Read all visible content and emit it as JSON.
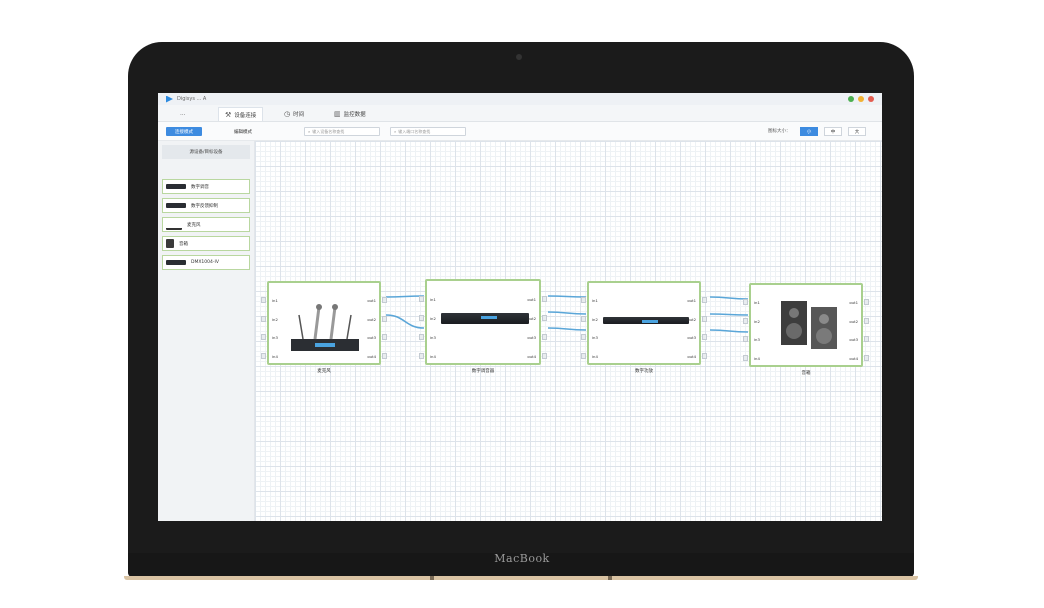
{
  "device_brand": "MacBook",
  "window": {
    "title": "Digisys ... A",
    "controls": [
      "#4caf50",
      "#f2b233",
      "#e45d50"
    ]
  },
  "tabs": [
    {
      "label": "…",
      "icon": "",
      "active": false
    },
    {
      "label": "设备连接",
      "icon": "wrench-icon",
      "active": true
    },
    {
      "label": "时间",
      "icon": "clock-icon",
      "active": false
    },
    {
      "label": "监控数据",
      "icon": "chart-icon",
      "active": false
    }
  ],
  "toolbar": {
    "primary_button": "连接模式",
    "secondary_button": "编辑模式",
    "search1_placeholder": "输入设备名称查找",
    "search2_placeholder": "输入端口名称查找",
    "size_label": "图标大小：",
    "sizes": [
      "小",
      "中",
      "大"
    ],
    "size_selected": 0
  },
  "sidebar": {
    "header": "源设备/目标设备",
    "items": [
      {
        "label": "数字调音",
        "thumb": "rack"
      },
      {
        "label": "数字反馈抑制",
        "thumb": "rack"
      },
      {
        "label": "麦克风",
        "thumb": "mic"
      },
      {
        "label": "音箱",
        "thumb": "spk"
      },
      {
        "label": "DMX1004-IV",
        "thumb": "rack"
      }
    ]
  },
  "nodes": [
    {
      "label": "麦克风",
      "image": "wireless-mic-icon",
      "inputs": [
        "in1",
        "in2",
        "in3",
        "in4"
      ],
      "outputs": [
        "out1",
        "out2",
        "out3",
        "out4"
      ]
    },
    {
      "label": "数字调音器",
      "image": "rack-processor-icon",
      "inputs": [
        "in1",
        "in2",
        "in3",
        "in4"
      ],
      "outputs": [
        "out1",
        "out2",
        "out3",
        "out4"
      ]
    },
    {
      "label": "数字功放",
      "image": "power-amplifier-icon",
      "inputs": [
        "in1",
        "in2",
        "in3",
        "in4"
      ],
      "outputs": [
        "out1",
        "out2",
        "out3",
        "out4"
      ]
    },
    {
      "label": "音箱",
      "image": "speaker-icon",
      "inputs": [
        "in1",
        "in2",
        "in3",
        "in4"
      ],
      "outputs": [
        "out1",
        "out2",
        "out3",
        "out4"
      ]
    }
  ],
  "colors": {
    "accent": "#3d8be0",
    "node_border": "#a9d08e",
    "wire": "#5aa6d8"
  }
}
